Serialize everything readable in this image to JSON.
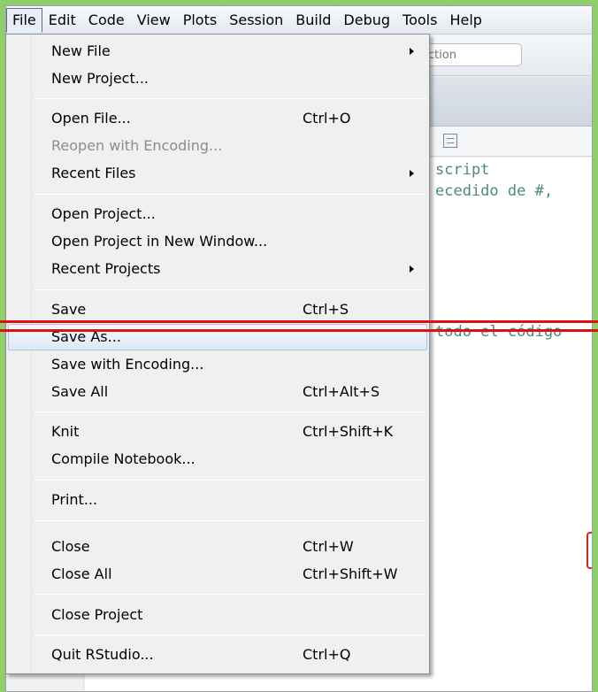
{
  "menubar": {
    "items": [
      "File",
      "Edit",
      "Code",
      "View",
      "Plots",
      "Session",
      "Build",
      "Debug",
      "Tools",
      "Help"
    ],
    "active": "File"
  },
  "toolbar": {
    "goto_placeholder": "ction"
  },
  "editor": {
    "lines": [
      "script",
      "ecedido de #,",
      "todo el código"
    ]
  },
  "file_menu": {
    "new_file": "New File",
    "new_project": "New Project...",
    "open_file": "Open File...",
    "open_file_shortcut": "Ctrl+O",
    "reopen_encoding": "Reopen with Encoding...",
    "recent_files": "Recent Files",
    "open_project": "Open Project...",
    "open_project_new_window": "Open Project in New Window...",
    "recent_projects": "Recent Projects",
    "save": "Save",
    "save_shortcut": "Ctrl+S",
    "save_as": "Save As...",
    "save_with_encoding": "Save with Encoding...",
    "save_all": "Save All",
    "save_all_shortcut": "Ctrl+Alt+S",
    "knit": "Knit",
    "knit_shortcut": "Ctrl+Shift+K",
    "compile_notebook": "Compile Notebook...",
    "print": "Print...",
    "close": "Close",
    "close_shortcut": "Ctrl+W",
    "close_all": "Close All",
    "close_all_shortcut": "Ctrl+Shift+W",
    "close_project": "Close Project",
    "quit": "Quit RStudio...",
    "quit_shortcut": "Ctrl+Q"
  },
  "colors": {
    "background": "#8fce6b",
    "highlight_annotation": "#e01010",
    "code_comment": "#4c8b7a"
  }
}
